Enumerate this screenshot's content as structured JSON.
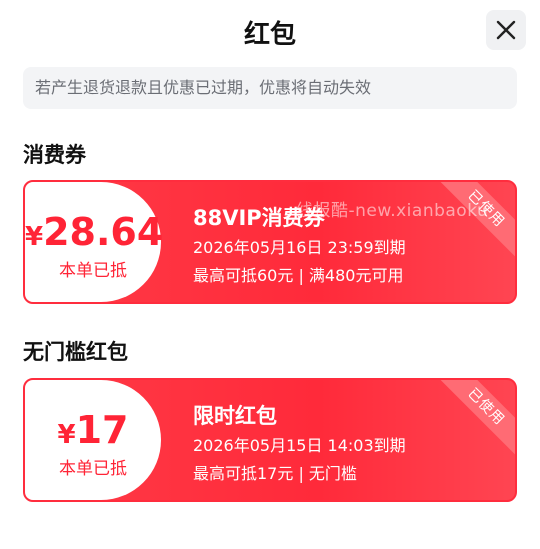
{
  "header": {
    "title": "红包"
  },
  "notice": "若产生退货退款且优惠已过期，优惠将自动失效",
  "sections": [
    {
      "title": "消费券",
      "coupon": {
        "symbol": "¥",
        "amount": "28.64",
        "note": "本单已抵",
        "name": "88VIP消费券",
        "time": "2026年05月16日 23:59到期",
        "rule": "最高可抵60元 | 满480元可用",
        "status": "已使用"
      }
    },
    {
      "title": "无门槛红包",
      "coupon": {
        "symbol": "¥",
        "amount": "17",
        "note": "本单已抵",
        "name": "限时红包",
        "time": "2026年05月15日 14:03到期",
        "rule": "最高可抵17元 | 无门槛",
        "status": "已使用"
      }
    }
  ],
  "watermark": "线报酷-new.xianbaoku",
  "colors": {
    "accent": "#ff2a3a",
    "ribbon": "#ff6b74",
    "notice_bg": "#f3f4f6"
  },
  "icons": {
    "close": "close-icon"
  }
}
